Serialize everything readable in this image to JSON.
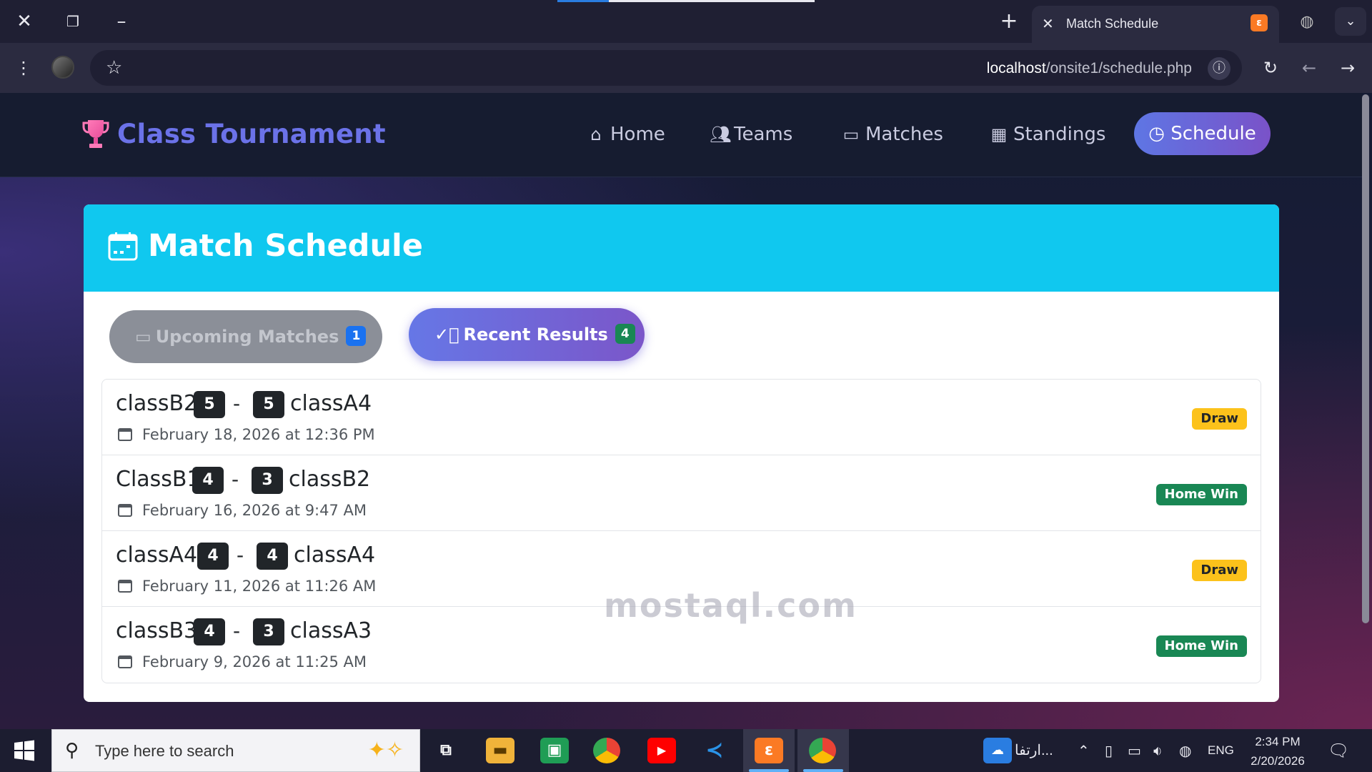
{
  "browser": {
    "tab_title": "Match Schedule",
    "url_host": "localhost",
    "url_path": "/onsite1/schedule.php"
  },
  "nav": {
    "brand": "Class Tournament",
    "items": [
      {
        "label": "Home",
        "icon": "home-icon"
      },
      {
        "label": "Teams",
        "icon": "people-icon"
      },
      {
        "label": "Matches",
        "icon": "calendar-icon"
      },
      {
        "label": "Standings",
        "icon": "table-icon"
      }
    ],
    "active": {
      "label": "Schedule",
      "icon": "clock-icon"
    }
  },
  "card": {
    "title": "Match Schedule",
    "tabs": {
      "upcoming": {
        "label": "Upcoming Matches",
        "count": "1"
      },
      "recent": {
        "label": "Recent Results",
        "count": "4"
      }
    }
  },
  "results": [
    {
      "home": "classB2",
      "home_score": "5",
      "away_score": "5",
      "away": "classA4",
      "date": "February 18, 2026 at 12:36 PM",
      "outcome": "Draw"
    },
    {
      "home": "ClassB1",
      "home_score": "4",
      "away_score": "3",
      "away": "classB2",
      "date": "February 16, 2026 at 9:47 AM",
      "outcome": "Home Win"
    },
    {
      "home": "classA4",
      "home_score": "4",
      "away_score": "4",
      "away": "classA4",
      "date": "February 11, 2026 at 11:26 AM",
      "outcome": "Draw"
    },
    {
      "home": "classB3",
      "home_score": "4",
      "away_score": "3",
      "away": "classA3",
      "date": "February 9, 2026 at 11:25 AM",
      "outcome": "Home Win"
    }
  ],
  "watermark": "mostaql.com",
  "taskbar": {
    "search_placeholder": "Type here to search",
    "weather_text": "ارتفا...",
    "lang": "ENG",
    "time": "2:34 PM",
    "date": "2/20/2026"
  },
  "colors": {
    "brand": "#6b72e8",
    "header": "#10c8ef",
    "draw": "#fcc21b",
    "win": "#198754"
  }
}
